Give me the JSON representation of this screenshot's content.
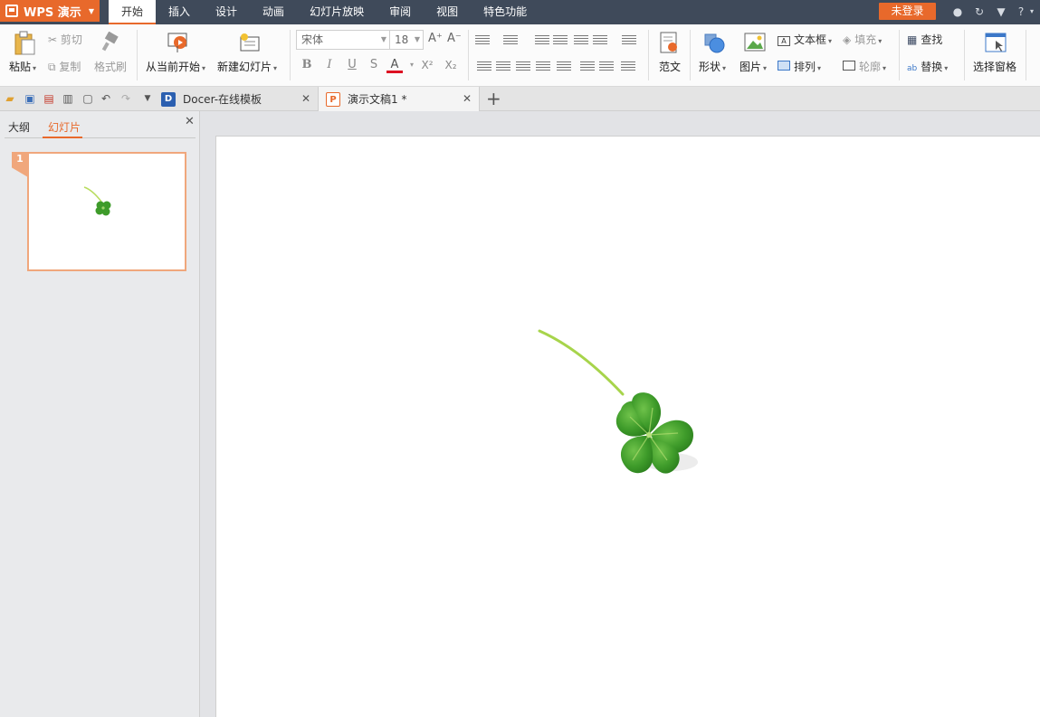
{
  "app": {
    "name": "WPS 演示"
  },
  "menu": {
    "items": [
      "开始",
      "插入",
      "设计",
      "动画",
      "幻灯片放映",
      "审阅",
      "视图",
      "特色功能"
    ],
    "active_index": 0
  },
  "account": {
    "login_label": "未登录"
  },
  "ribbon": {
    "paste": "粘贴",
    "cut": "剪切",
    "copy": "复制",
    "format_painter": "格式刷",
    "from_current": "从当前开始",
    "new_slide": "新建幻灯片",
    "font_name": "宋体",
    "font_size": "18",
    "bold": "B",
    "italic": "I",
    "underline": "U",
    "strike": "S",
    "font_color": "A",
    "superscript": "X²",
    "subscript": "X₂",
    "grow": "A⁺",
    "shrink": "A⁻",
    "template": "范文",
    "shape": "形状",
    "picture": "图片",
    "textbox": "文本框",
    "arrange": "排列",
    "fill": "填充",
    "outline": "轮廓",
    "find": "查找",
    "replace": "替换",
    "selection_pane": "选择窗格"
  },
  "tabs": [
    {
      "label": "Docer-在线模板",
      "icon": "docer-icon",
      "active": false
    },
    {
      "label": "演示文稿1 *",
      "icon": "presentation-doc-icon",
      "active": true
    }
  ],
  "left_pane": {
    "tabs": [
      "大纲",
      "幻灯片"
    ],
    "active_index": 1,
    "slide_number": "1"
  },
  "colors": {
    "accent": "#e8692b",
    "menubar": "#3f4a5a",
    "clover": "#3e9b2a"
  }
}
